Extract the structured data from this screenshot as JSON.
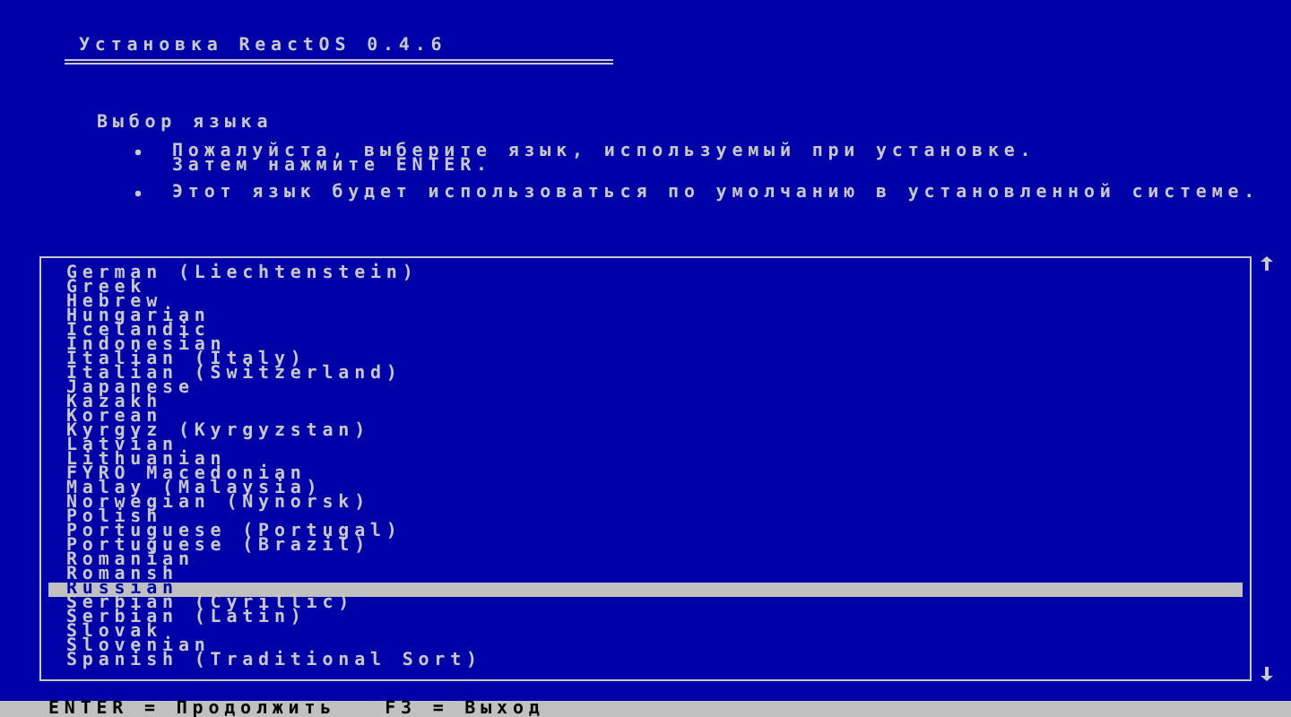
{
  "header": {
    "title": "Установка ReactOS 0.4.6"
  },
  "section_title": "Выбор языка",
  "bullets": [
    {
      "lines": [
        "Пожалуйста, выберите язык, используемый при установке.",
        "Затем нажмите ENTER."
      ]
    },
    {
      "lines": [
        "Этот язык будет использоваться по умолчанию в установленной системе."
      ]
    }
  ],
  "languages": [
    {
      "label": "German (Liechtenstein)",
      "selected": false
    },
    {
      "label": "Greek",
      "selected": false
    },
    {
      "label": "Hebrew",
      "selected": false
    },
    {
      "label": "Hungarian",
      "selected": false
    },
    {
      "label": "Icelandic",
      "selected": false
    },
    {
      "label": "Indonesian",
      "selected": false
    },
    {
      "label": "Italian (Italy)",
      "selected": false
    },
    {
      "label": "Italian (Switzerland)",
      "selected": false
    },
    {
      "label": "Japanese",
      "selected": false
    },
    {
      "label": "Kazakh",
      "selected": false
    },
    {
      "label": "Korean",
      "selected": false
    },
    {
      "label": "Kyrgyz (Kyrgyzstan)",
      "selected": false
    },
    {
      "label": "Latvian",
      "selected": false
    },
    {
      "label": "Lithuanian",
      "selected": false
    },
    {
      "label": "FYRO Macedonian",
      "selected": false
    },
    {
      "label": "Malay (Malaysia)",
      "selected": false
    },
    {
      "label": "Norwegian (Nynorsk)",
      "selected": false
    },
    {
      "label": "Polish",
      "selected": false
    },
    {
      "label": "Portuguese (Portugal)",
      "selected": false
    },
    {
      "label": "Portuguese (Brazil)",
      "selected": false
    },
    {
      "label": "Romanian",
      "selected": false
    },
    {
      "label": "Romansh",
      "selected": false
    },
    {
      "label": "Russian",
      "selected": true
    },
    {
      "label": "Serbian (Cyrillic)",
      "selected": false
    },
    {
      "label": "Serbian (Latin)",
      "selected": false
    },
    {
      "label": "Slovak",
      "selected": false
    },
    {
      "label": "Slovenian",
      "selected": false
    },
    {
      "label": "Spanish (Traditional Sort)",
      "selected": false
    }
  ],
  "status_bar": {
    "hints": [
      "ENTER = Продолжить",
      "F3 = Выход"
    ]
  }
}
